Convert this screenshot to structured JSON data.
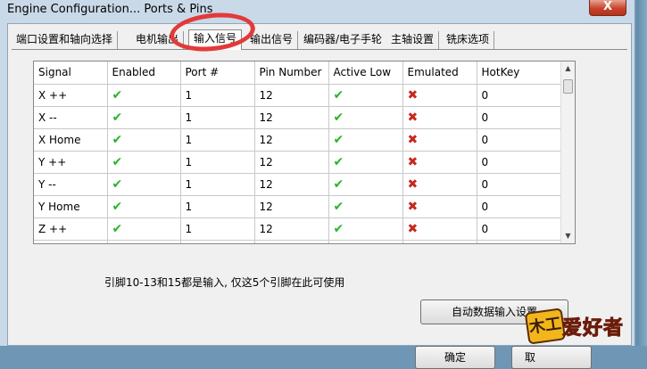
{
  "window": {
    "title": "Engine Configuration... Ports & Pins",
    "close_label": "X"
  },
  "tabs": [
    {
      "label": "端口设置和轴向选择"
    },
    {
      "label": "电机输出"
    },
    {
      "label": "输入信号"
    },
    {
      "label": "输出信号"
    },
    {
      "label": "编码器/电子手轮"
    },
    {
      "label": "主轴设置"
    },
    {
      "label": "铣床选项"
    }
  ],
  "active_tab": "输入信号",
  "grid": {
    "headers": [
      "Signal",
      "Enabled",
      "Port #",
      "Pin Number",
      "Active Low",
      "Emulated",
      "HotKey"
    ],
    "rows": [
      {
        "signal": "X ++",
        "port": "1",
        "pin": "12",
        "hotkey": "0"
      },
      {
        "signal": "X --",
        "port": "1",
        "pin": "12",
        "hotkey": "0"
      },
      {
        "signal": "X Home",
        "port": "1",
        "pin": "12",
        "hotkey": "0"
      },
      {
        "signal": "Y ++",
        "port": "1",
        "pin": "12",
        "hotkey": "0"
      },
      {
        "signal": "Y --",
        "port": "1",
        "pin": "12",
        "hotkey": "0"
      },
      {
        "signal": "Y Home",
        "port": "1",
        "pin": "12",
        "hotkey": "0"
      },
      {
        "signal": "Z ++",
        "port": "1",
        "pin": "12",
        "hotkey": "0"
      }
    ],
    "check_glyph": "✔",
    "cross_glyph": "✖",
    "check_color": "#2bb32b",
    "cross_color": "#c8281e"
  },
  "info_text": "引脚10-13和15都是输入, 仅这5个引脚在此可使用",
  "buttons": {
    "auto_input": "自动数据输入设置",
    "ok": "确定",
    "cancel": "取"
  },
  "watermark": {
    "badge": "木工",
    "text": "爱好者"
  },
  "colors": {
    "highlight": "#e23a3a",
    "titlebar": "#c9d9e8"
  }
}
